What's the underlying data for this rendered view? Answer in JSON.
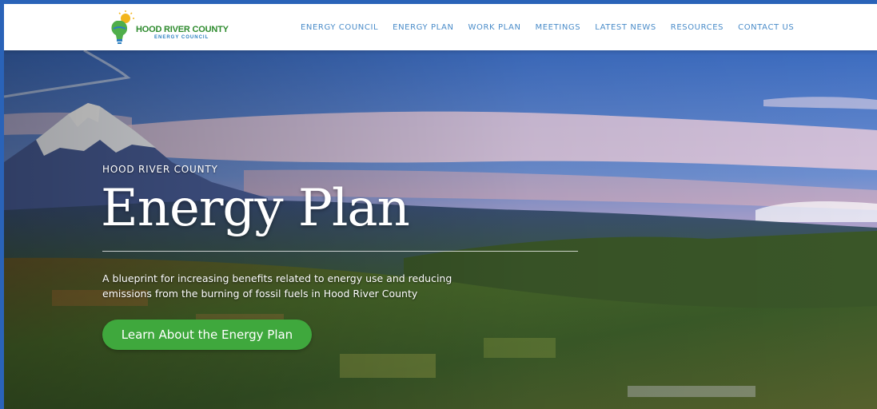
{
  "header": {
    "logo": {
      "title": "HOOD RIVER COUNTY",
      "subtitle": "ENERGY COUNCIL",
      "icon": "lightbulb-sun-icon"
    },
    "nav": [
      {
        "label": "ENERGY COUNCIL"
      },
      {
        "label": "ENERGY PLAN"
      },
      {
        "label": "WORK PLAN"
      },
      {
        "label": "MEETINGS"
      },
      {
        "label": "LATEST NEWS"
      },
      {
        "label": "RESOURCES"
      },
      {
        "label": "CONTACT US"
      }
    ]
  },
  "hero": {
    "eyebrow": "HOOD RIVER COUNTY",
    "title": "Energy Plan",
    "description": "A blueprint for increasing benefits related to energy use and reducing emissions from the burning of fossil fuels in Hood River County",
    "cta_label": "Learn About the Energy Plan"
  },
  "colors": {
    "frame_blue": "#2a63b8",
    "nav_text": "#4a8cc9",
    "cta_green": "#3fa83d",
    "logo_green": "#2e8b2e"
  }
}
